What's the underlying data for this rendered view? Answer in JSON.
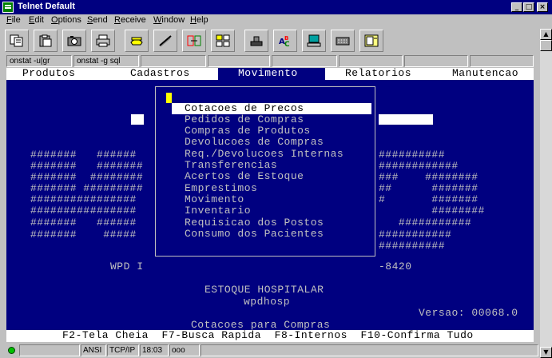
{
  "window": {
    "title": "Telnet Default",
    "min_glyph": "_",
    "max_glyph": "□",
    "close_glyph": "×"
  },
  "menu": {
    "items": [
      {
        "label": "File",
        "accel": "F",
        "rest": "ile"
      },
      {
        "label": "Edit",
        "accel": "E",
        "rest": "dit"
      },
      {
        "label": "Options",
        "accel": "O",
        "rest": "ptions"
      },
      {
        "label": "Send",
        "accel": "S",
        "rest": "end"
      },
      {
        "label": "Receive",
        "accel": "R",
        "rest": "eceive"
      },
      {
        "label": "Window",
        "accel": "W",
        "rest": "indow"
      },
      {
        "label": "Help",
        "accel": "H",
        "rest": "elp"
      }
    ]
  },
  "toolbar": {
    "icons": [
      "copy-icon",
      "paste-icon",
      "camera-icon",
      "print-icon",
      "phone-icon",
      "pen-icon",
      "transfer-icon",
      "layout-icon",
      "stamp-icon",
      "spellcheck-icon",
      "computer-icon",
      "keyboard-icon",
      "panel-icon"
    ]
  },
  "scrollbar": {
    "up": "▲",
    "down": "▼"
  },
  "tabs": [
    "onstat -u|gr",
    "onstat -g sql",
    "",
    "",
    "",
    "",
    "",
    ""
  ],
  "terminal": {
    "menu": [
      "Produtos",
      "Cadastros",
      "Movimento",
      "Relatorios",
      "Manutencao"
    ],
    "popup_items": [
      "Cotacoes de Precos",
      "Pedidos de Compras",
      "Compras de Produtos",
      "Devolucoes de Compras",
      "Req./Devolucoes Internas",
      "Transferencias",
      "Acertos de Estoque",
      "Emprestimos",
      "Movimento",
      "Inventario",
      "Requisicao dos Postos",
      "Consumo dos Pacientes"
    ],
    "banner_left": [
      "#######   ######",
      "#######   #######",
      "#######  ########",
      "####### #########",
      "################",
      "################",
      "#######   ######",
      "#######    #####"
    ],
    "banner_right": [
      "##########",
      "############",
      "###    ########",
      "##      #######",
      "#       #######",
      "        ########",
      "   ###########",
      "###########",
      "##########"
    ],
    "wpd_label": "WPD I",
    "version_code": "-8420",
    "system_title": "ESTOQUE HOSPITALAR",
    "system_host": "wpdhosp",
    "version": "Versao: 00068.0",
    "context": "Cotacoes para Compras",
    "function_keys": "F2-Tela Cheia  F7-Busca Rapida  F8-Internos  F10-Confirma Tudo"
  },
  "status": {
    "terminal_type": "ANSI",
    "protocol": "TCP/IP",
    "time": "18:03",
    "indicator": "ooo"
  }
}
